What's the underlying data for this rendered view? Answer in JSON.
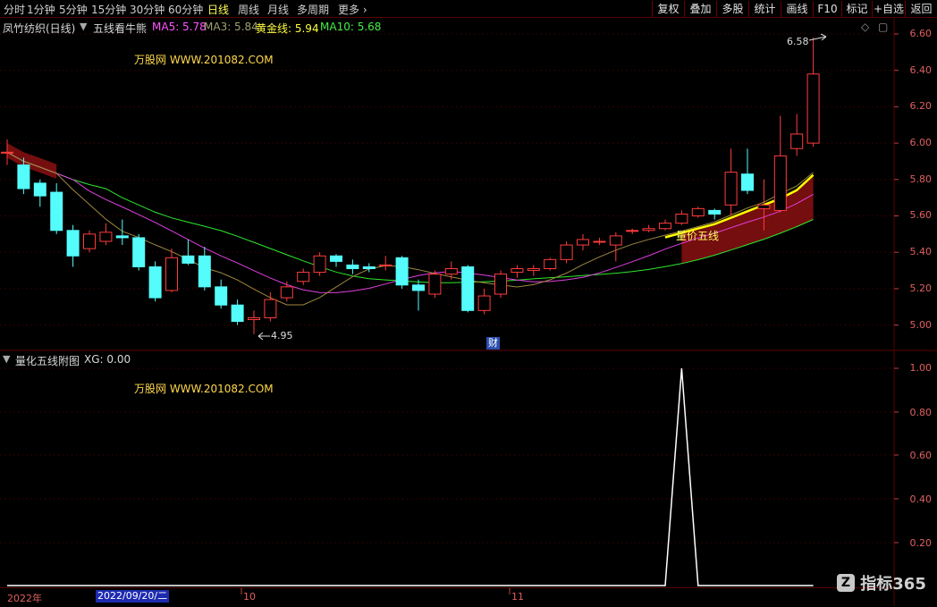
{
  "toolbar": {
    "periods": [
      "分时",
      "1分钟",
      "5分钟",
      "15分钟",
      "30分钟",
      "60分钟",
      "日线",
      "周线",
      "月线",
      "多周期",
      "更多"
    ],
    "active_period": "日线",
    "right_buttons": [
      "复权",
      "叠加",
      "多股",
      "统计",
      "画线",
      "F10",
      "标记",
      "+自选",
      "返回"
    ]
  },
  "main_info": {
    "stock": "凤竹纺织(日线)",
    "indicator": "五线看牛熊",
    "ma5": "MA5: 5.78",
    "ma3": "MA3: 5.84",
    "gold": "黄金线: 5.94",
    "ma10": "MA10: 5.68"
  },
  "sub_info": {
    "indicator": "量化五线附图",
    "xg": "XG: 0.00"
  },
  "watermark_site": "万股网 WWW.201082.COM",
  "annotations": {
    "high": "6.58",
    "low": "4.95",
    "signal": "量价五线",
    "cai": "财"
  },
  "main_axis": {
    "labels": [
      "6.60",
      "6.40",
      "6.20",
      "6.00",
      "5.80",
      "5.60",
      "5.40",
      "5.20",
      "5.00"
    ],
    "min": 4.9,
    "max": 6.65
  },
  "sub_axis": {
    "labels": [
      "1.00",
      "0.80",
      "0.60",
      "0.40",
      "0.20"
    ]
  },
  "date_axis": {
    "year": "2022年",
    "cursor_date": "2022/09/20/二",
    "months": [
      "10",
      "11"
    ]
  },
  "logo": "指标365",
  "colors": {
    "up": "#ff3c3c",
    "down": "#54fcfc",
    "ma_green": "#2ee82e",
    "ma_magenta": "#e040e0",
    "gold": "#ffff00",
    "grid": "#5a0000"
  },
  "chart_data": {
    "type": "candlestick",
    "price_candles": [
      {
        "o": 5.95,
        "c": 5.95,
        "h": 6.02,
        "l": 5.88
      },
      {
        "o": 5.88,
        "c": 5.75,
        "h": 5.92,
        "l": 5.72
      },
      {
        "o": 5.78,
        "c": 5.71,
        "h": 5.8,
        "l": 5.65
      },
      {
        "o": 5.73,
        "c": 5.52,
        "h": 5.78,
        "l": 5.5
      },
      {
        "o": 5.52,
        "c": 5.38,
        "h": 5.55,
        "l": 5.32
      },
      {
        "o": 5.42,
        "c": 5.5,
        "h": 5.52,
        "l": 5.4
      },
      {
        "o": 5.46,
        "c": 5.51,
        "h": 5.56,
        "l": 5.44
      },
      {
        "o": 5.49,
        "c": 5.48,
        "h": 5.58,
        "l": 5.44
      },
      {
        "o": 5.48,
        "c": 5.32,
        "h": 5.5,
        "l": 5.3
      },
      {
        "o": 5.32,
        "c": 5.15,
        "h": 5.35,
        "l": 5.13
      },
      {
        "o": 5.19,
        "c": 5.37,
        "h": 5.42,
        "l": 5.18
      },
      {
        "o": 5.38,
        "c": 5.34,
        "h": 5.47,
        "l": 5.33
      },
      {
        "o": 5.38,
        "c": 5.21,
        "h": 5.43,
        "l": 5.19
      },
      {
        "o": 5.21,
        "c": 5.11,
        "h": 5.25,
        "l": 5.09
      },
      {
        "o": 5.11,
        "c": 5.02,
        "h": 5.14,
        "l": 5.0
      },
      {
        "o": 5.03,
        "c": 5.04,
        "h": 5.08,
        "l": 4.95
      },
      {
        "o": 5.04,
        "c": 5.14,
        "h": 5.18,
        "l": 5.02
      },
      {
        "o": 5.15,
        "c": 5.21,
        "h": 5.24,
        "l": 5.13
      },
      {
        "o": 5.24,
        "c": 5.29,
        "h": 5.31,
        "l": 5.22
      },
      {
        "o": 5.29,
        "c": 5.38,
        "h": 5.4,
        "l": 5.27
      },
      {
        "o": 5.38,
        "c": 5.35,
        "h": 5.39,
        "l": 5.32
      },
      {
        "o": 5.33,
        "c": 5.31,
        "h": 5.36,
        "l": 5.28
      },
      {
        "o": 5.32,
        "c": 5.31,
        "h": 5.34,
        "l": 5.29
      },
      {
        "o": 5.33,
        "c": 5.33,
        "h": 5.38,
        "l": 5.3
      },
      {
        "o": 5.37,
        "c": 5.22,
        "h": 5.38,
        "l": 5.2
      },
      {
        "o": 5.22,
        "c": 5.19,
        "h": 5.25,
        "l": 5.08
      },
      {
        "o": 5.17,
        "c": 5.28,
        "h": 5.3,
        "l": 5.15
      },
      {
        "o": 5.28,
        "c": 5.31,
        "h": 5.35,
        "l": 5.25
      },
      {
        "o": 5.32,
        "c": 5.08,
        "h": 5.33,
        "l": 5.07
      },
      {
        "o": 5.08,
        "c": 5.16,
        "h": 5.2,
        "l": 5.06
      },
      {
        "o": 5.17,
        "c": 5.28,
        "h": 5.3,
        "l": 5.15
      },
      {
        "o": 5.29,
        "c": 5.31,
        "h": 5.33,
        "l": 5.26
      },
      {
        "o": 5.3,
        "c": 5.31,
        "h": 5.33,
        "l": 5.27
      },
      {
        "o": 5.31,
        "c": 5.36,
        "h": 5.37,
        "l": 5.3
      },
      {
        "o": 5.36,
        "c": 5.44,
        "h": 5.46,
        "l": 5.34
      },
      {
        "o": 5.44,
        "c": 5.47,
        "h": 5.5,
        "l": 5.41
      },
      {
        "o": 5.46,
        "c": 5.46,
        "h": 5.48,
        "l": 5.44
      },
      {
        "o": 5.44,
        "c": 5.49,
        "h": 5.51,
        "l": 5.35
      },
      {
        "o": 5.52,
        "c": 5.52,
        "h": 5.53,
        "l": 5.5
      },
      {
        "o": 5.52,
        "c": 5.53,
        "h": 5.55,
        "l": 5.51
      },
      {
        "o": 5.53,
        "c": 5.56,
        "h": 5.58,
        "l": 5.52
      },
      {
        "o": 5.56,
        "c": 5.61,
        "h": 5.63,
        "l": 5.55
      },
      {
        "o": 5.6,
        "c": 5.64,
        "h": 5.65,
        "l": 5.59
      },
      {
        "o": 5.63,
        "c": 5.61,
        "h": 5.64,
        "l": 5.58
      },
      {
        "o": 5.66,
        "c": 5.84,
        "h": 5.97,
        "l": 5.6
      },
      {
        "o": 5.83,
        "c": 5.74,
        "h": 5.97,
        "l": 5.72
      },
      {
        "o": 5.64,
        "c": 5.66,
        "h": 5.8,
        "l": 5.52
      },
      {
        "o": 5.63,
        "c": 5.93,
        "h": 6.15,
        "l": 5.62
      },
      {
        "o": 5.97,
        "c": 6.05,
        "h": 6.16,
        "l": 5.93
      },
      {
        "o": 6.0,
        "c": 6.38,
        "h": 6.58,
        "l": 5.98
      }
    ],
    "signal": [
      0,
      0,
      0,
      0,
      0,
      0,
      0,
      0,
      0,
      0,
      0,
      0,
      0,
      0,
      0,
      0,
      0,
      0,
      0,
      0,
      0,
      0,
      0,
      0,
      0,
      0,
      0,
      0,
      0,
      0,
      0,
      0,
      0,
      0,
      0,
      0,
      0,
      0,
      0,
      0,
      0,
      1,
      0,
      0,
      0,
      0,
      0,
      0,
      0,
      0
    ]
  }
}
